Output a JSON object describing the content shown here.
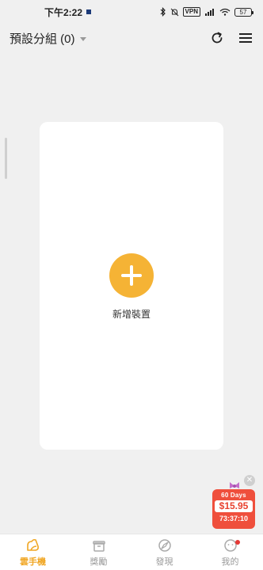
{
  "status_bar": {
    "time": "下午2:22",
    "vpn": "VPN",
    "battery": "57"
  },
  "header": {
    "group_title": "預設分組 (0)"
  },
  "card": {
    "add_label": "新增裝置"
  },
  "promo": {
    "days": "60 Days",
    "price": "$15.95",
    "timer": "73:37:10"
  },
  "bottom_nav": {
    "items": [
      {
        "label": "雲手機",
        "icon": "cloud-phone-icon",
        "active": true
      },
      {
        "label": "獎勵",
        "icon": "gift-bag-icon",
        "active": false
      },
      {
        "label": "發現",
        "icon": "discover-icon",
        "active": false
      },
      {
        "label": "我的",
        "icon": "profile-icon",
        "active": false
      }
    ]
  },
  "colors": {
    "accent": "#f5b335",
    "background": "#f0f0f0",
    "promo": "#ef4f3c"
  }
}
